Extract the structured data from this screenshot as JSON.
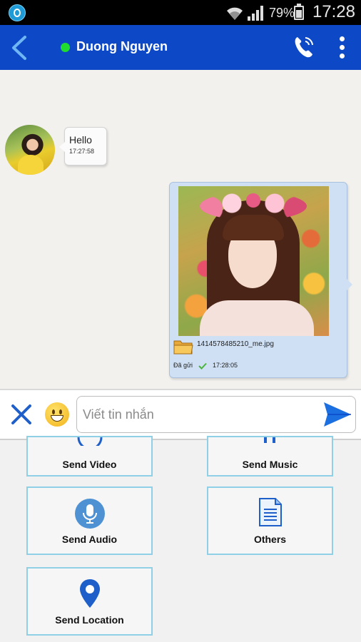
{
  "status_bar": {
    "battery_percent": "79%",
    "time": "17:28"
  },
  "header": {
    "contact_name": "Duong Nguyen",
    "online_status": "online",
    "colors": {
      "bar": "#0d49c7",
      "online_dot": "#1fdc2e"
    }
  },
  "messages": [
    {
      "direction": "incoming",
      "text": "Hello",
      "time": "17:27:58"
    },
    {
      "direction": "outgoing",
      "type": "image",
      "file_name": "1414578485210_me.jpg",
      "status": "Đã gửi",
      "time": "17:28:05"
    }
  ],
  "composer": {
    "placeholder": "Viết tin nhắn",
    "value": ""
  },
  "attachments": [
    {
      "label": "Send Video",
      "icon": "video-icon"
    },
    {
      "label": "Send Music",
      "icon": "music-icon"
    },
    {
      "label": "Send Audio",
      "icon": "microphone-icon"
    },
    {
      "label": "Others",
      "icon": "document-icon"
    },
    {
      "label": "Send Location",
      "icon": "location-pin-icon"
    }
  ]
}
